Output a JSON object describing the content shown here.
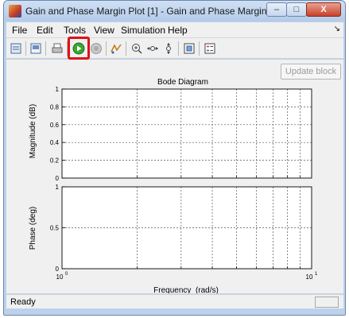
{
  "window": {
    "title": "Gain and Phase Margin Plot [1] - Gain and Phase Margin Plot",
    "controls": {
      "minimize": "–",
      "maximize": "□",
      "close": "X"
    }
  },
  "menubar": {
    "items": [
      "File",
      "Edit",
      "Tools",
      "View",
      "Simulation",
      "Help"
    ],
    "overflow": "↘"
  },
  "toolbar": {
    "icons": [
      "open-icon",
      "print-preview-icon",
      "print-icon",
      "play-icon",
      "stop-icon",
      "signal-selector-icon",
      "zoom-in-icon",
      "zoom-x-icon",
      "zoom-y-icon",
      "autoscale-icon",
      "legend-icon"
    ],
    "highlight_color": "#e0101a"
  },
  "panel": {
    "update_button": "Update block"
  },
  "chart_data": [
    {
      "type": "line",
      "title": "Bode Diagram",
      "ylabel": "Magnitude (dB)",
      "xscale": "log",
      "xlim": [
        1,
        10
      ],
      "ylim": [
        0,
        1
      ],
      "yticks": [
        "0",
        "0.2",
        "0.4",
        "0.6",
        "0.8",
        "1"
      ],
      "grid": true,
      "series": []
    },
    {
      "type": "line",
      "ylabel": "Phase (deg)",
      "xlabel": "Frequency  (rad/s)",
      "xscale": "log",
      "xlim": [
        1,
        10
      ],
      "ylim": [
        0,
        1
      ],
      "yticks": [
        "0",
        "0.5",
        "1"
      ],
      "xtick_labels": [
        "10",
        "10"
      ],
      "xtick_exponents": [
        "0",
        "1"
      ],
      "grid": true,
      "series": []
    }
  ],
  "status": {
    "text": "Ready"
  }
}
